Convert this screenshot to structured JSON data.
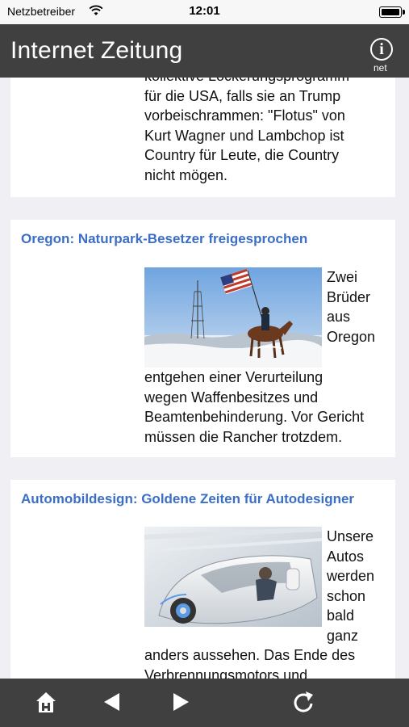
{
  "status": {
    "carrier": "Netzbetreiber",
    "time": "12:01"
  },
  "navbar": {
    "title": "Internet Zeitung",
    "info_icon": "info-circle-icon",
    "info_caption": "net"
  },
  "articles": [
    {
      "headline": "",
      "lines": [
        "kollektive Lockerungsprogramm",
        "für die USA, falls sie an Trump",
        "vorbeischrammen: \"Flotus\" von",
        "Kurt Wagner und Lambchop ist",
        "Country für Leute, die Country",
        "nicht mögen."
      ]
    },
    {
      "headline": "Oregon: Naturpark-Besetzer freigesprochen",
      "side_lines": [
        "Zwei",
        "Brüder",
        "aus",
        "Oregon"
      ],
      "lines": [
        "entgehen einer Verurteilung",
        "wegen Waffenbesitzes und",
        "Beamtenbehinderung. Vor Gericht",
        "müssen die Rancher trotzdem."
      ]
    },
    {
      "headline": "Automobildesign: Goldene Zeiten für Autodesigner",
      "side_lines": [
        "Unsere",
        "Autos",
        "werden",
        "schon",
        "bald",
        "ganz"
      ],
      "lines": [
        "anders aussehen. Das Ende des",
        "Verbrennungsmotors und"
      ]
    }
  ],
  "toolbar": {
    "home": "home-icon",
    "back": "back-arrow-icon",
    "forward": "forward-arrow-icon",
    "reload": "reload-icon"
  },
  "colors": {
    "navbar": "#404040",
    "headline": "#3b6fc5",
    "background": "#efeff4"
  }
}
